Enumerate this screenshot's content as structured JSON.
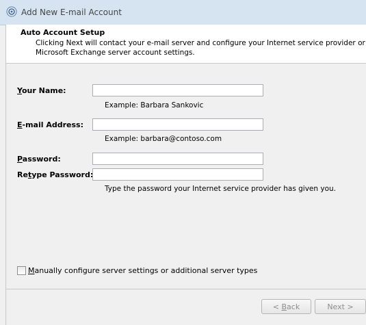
{
  "window": {
    "title": "Add New E-mail Account"
  },
  "header": {
    "title": "Auto Account Setup",
    "description": "Clicking Next will contact your e-mail server and configure your Internet service provider or Microsoft Exchange server account settings."
  },
  "form": {
    "name": {
      "label_accel": "Y",
      "label_rest": "our Name:",
      "value": "",
      "hint": "Example: Barbara Sankovic"
    },
    "email": {
      "label_accel": "E",
      "label_rest": "-mail Address:",
      "value": "",
      "hint": "Example: barbara@contoso.com"
    },
    "password": {
      "label_accel": "P",
      "label_rest": "assword:",
      "value": ""
    },
    "retype": {
      "label_pre": "Re",
      "label_accel": "t",
      "label_rest": "ype Password:",
      "value": "",
      "hint": "Type the password your Internet service provider has given you."
    }
  },
  "manual": {
    "checked": false,
    "label_accel": "M",
    "label_rest": "anually configure server settings or additional server types"
  },
  "buttons": {
    "back": {
      "pre": "< ",
      "accel": "B",
      "rest": "ack"
    },
    "next": {
      "label": "Next >"
    }
  },
  "colors": {
    "titlebar": "#d6e3f1",
    "body": "#f0f0f0",
    "header": "#ffffff",
    "disabled_text": "#8d8d8d"
  },
  "icons": {
    "window": "mail-account-icon"
  }
}
